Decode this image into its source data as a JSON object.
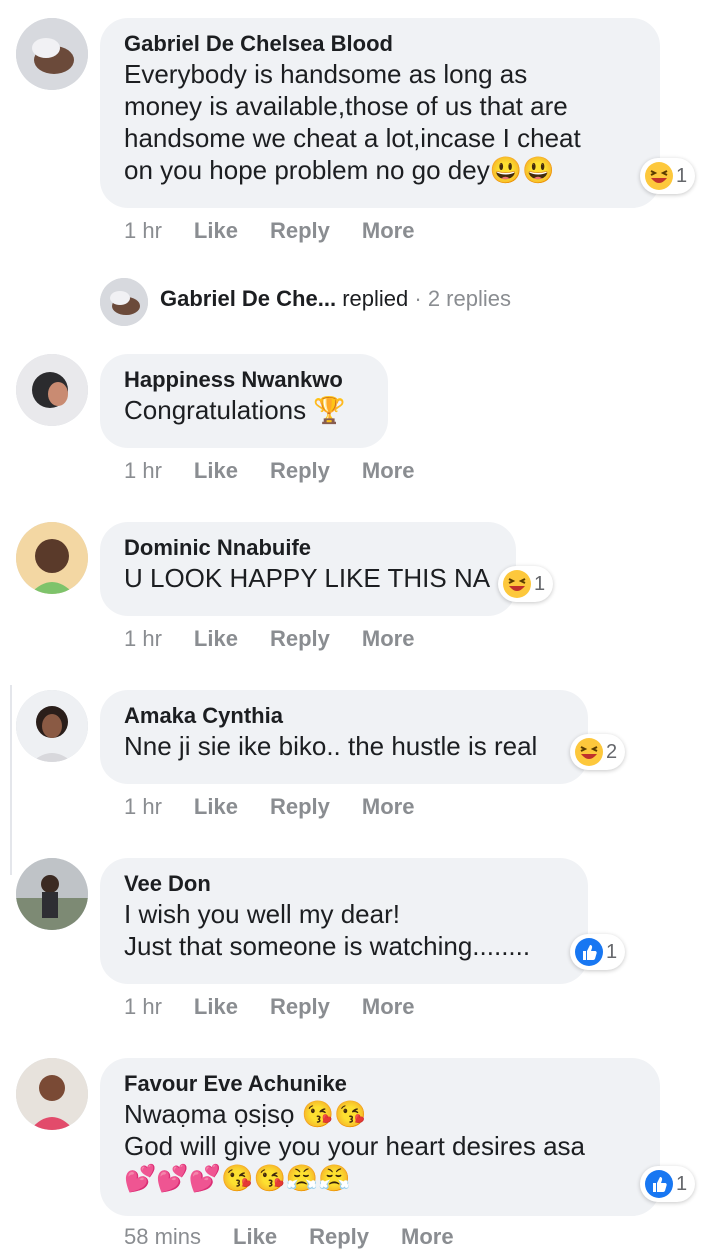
{
  "comments": [
    {
      "name": "Gabriel De Chelsea Blood",
      "lines": [
        "Everybody is handsome as long as",
        "money is available,those of us that are",
        "handsome we cheat a lot,incase I cheat",
        "on you hope problem no go dey😃😃"
      ],
      "reaction": {
        "icon": "laughing-emoji-icon",
        "count": "1"
      },
      "time": "1 hr",
      "like": "Like",
      "reply": "Reply",
      "more": "More"
    },
    {
      "name": "Happiness Nwankwo",
      "lines": [
        "Congratulations 🏆"
      ],
      "time": "1 hr",
      "like": "Like",
      "reply": "Reply",
      "more": "More"
    },
    {
      "name": "Dominic Nnabuife",
      "lines": [
        "U LOOK HAPPY LIKE THIS NA"
      ],
      "reaction": {
        "icon": "laughing-emoji-icon",
        "count": "1"
      },
      "time": "1 hr",
      "like": "Like",
      "reply": "Reply",
      "more": "More"
    },
    {
      "name": "Amaka Cynthia",
      "lines": [
        "Nne ji sie ike biko.. the hustle is real"
      ],
      "reaction": {
        "icon": "laughing-emoji-icon",
        "count": "2"
      },
      "time": "1 hr",
      "like": "Like",
      "reply": "Reply",
      "more": "More"
    },
    {
      "name": "Vee Don",
      "lines": [
        "I wish you well my dear!",
        "Just that someone is watching........"
      ],
      "reaction": {
        "icon": "thumbs-up-icon",
        "count": "1"
      },
      "time": "1 hr",
      "like": "Like",
      "reply": "Reply",
      "more": "More"
    },
    {
      "name": "Favour Eve Achunike",
      "lines": [
        "Nwaọma ọsịsọ 😘😘",
        "God will give you your heart desires asa",
        "💕💕💕😘😘😤😤"
      ],
      "reaction": {
        "icon": "thumbs-up-icon",
        "count": "1"
      },
      "time": "58 mins",
      "like": "Like",
      "reply": "Reply",
      "more": "More"
    }
  ],
  "reply_summary": {
    "name": "Gabriel De Che...",
    "action": "replied",
    "separator": "·",
    "count": "2 replies"
  },
  "colors": {
    "bubble": "#f0f2f5",
    "like_blue": "#1877f2",
    "emoji_yellow": "#fdc83c",
    "meta_gray": "#8a8d91"
  }
}
